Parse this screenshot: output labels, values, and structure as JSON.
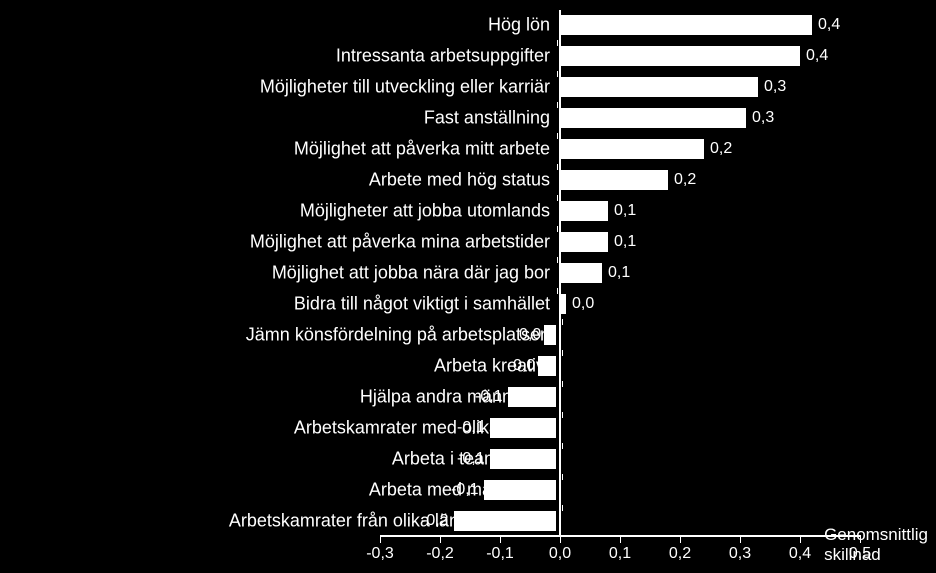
{
  "chart_data": {
    "type": "bar",
    "orientation": "horizontal",
    "xlabel": "Genomsnittlig skillnad",
    "xlim": [
      -0.3,
      0.5
    ],
    "xticks": [
      -0.3,
      -0.2,
      -0.1,
      0.0,
      0.1,
      0.2,
      0.3,
      0.4,
      0.5
    ],
    "xticklabels": [
      "-0,3",
      "-0,2",
      "-0,1",
      "0,0",
      "0,1",
      "0,2",
      "0,3",
      "0,4",
      "0,5"
    ],
    "categories": [
      "Hög lön",
      "Intressanta arbetsuppgifter",
      "Möjligheter till utveckling eller karriär",
      "Fast anställning",
      "Möjlighet att påverka mitt arbete",
      "Arbete med hög status",
      "Möjligheter att jobba utomlands",
      "Möjlighet att påverka mina arbetstider",
      "Möjlighet att jobba nära där jag bor",
      "Bidra till något viktigt i samhället",
      "Jämn könsfördelning på arbetsplatsen",
      "Arbeta kreativt",
      "Hjälpa andra människor",
      "Arbetskamrater med olika åldrar",
      "Arbeta i team/grupp",
      "Arbeta med människor",
      "Arbetskamrater från olika länder/kulturer"
    ],
    "values": [
      0.42,
      0.4,
      0.33,
      0.31,
      0.24,
      0.18,
      0.08,
      0.08,
      0.07,
      0.01,
      -0.02,
      -0.03,
      -0.08,
      -0.11,
      -0.11,
      -0.12,
      -0.17
    ],
    "value_labels": [
      "0,4",
      "0,4",
      "0,3",
      "0,3",
      "0,2",
      "0,2",
      "0,1",
      "0,1",
      "0,1",
      "0,0",
      "0,0",
      "0,0",
      "-0,1",
      "-0,1",
      "-0,1",
      "-0,1",
      "-0,2"
    ]
  }
}
